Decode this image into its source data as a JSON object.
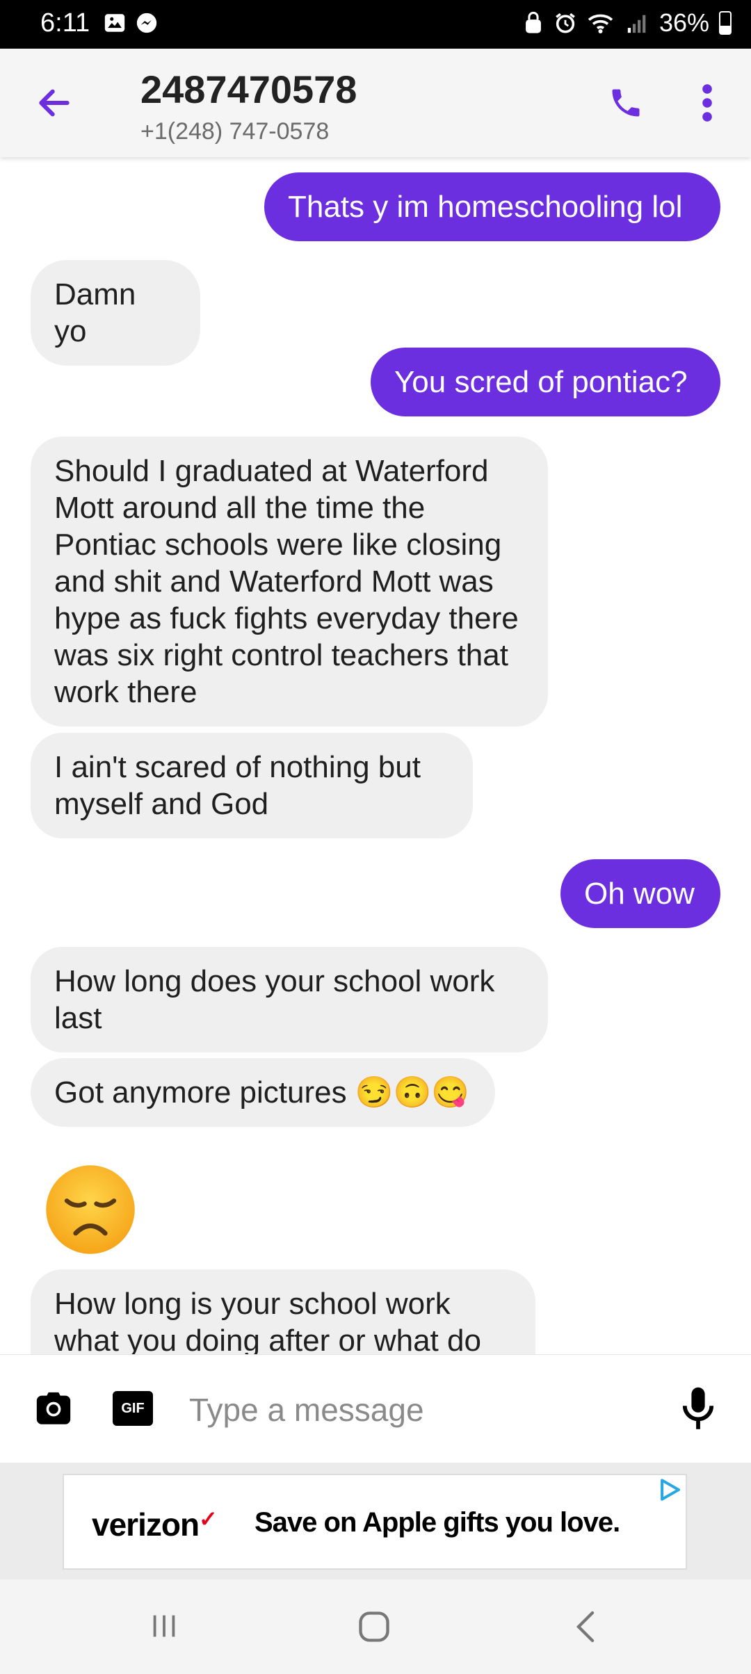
{
  "status_bar": {
    "time": "6:11",
    "battery": "36%",
    "battery_level": 0.36
  },
  "header": {
    "contact_name": "2487470578",
    "contact_number": "+1(248) 747-0578"
  },
  "messages": [
    {
      "direction": "out",
      "text": "Thats y im homeschooling lol"
    },
    {
      "direction": "in",
      "text": "Damn yo"
    },
    {
      "direction": "out",
      "text": "You scred of pontiac?"
    },
    {
      "direction": "in",
      "text": "Should I graduated at Waterford Mott around all the time the Pontiac schools were like closing and shit and Waterford Mott was hype as fuck fights everyday there was six right control teachers that work there"
    },
    {
      "direction": "in",
      "text": "I ain't scared of nothing but myself and God"
    },
    {
      "direction": "out",
      "text": "Oh wow"
    },
    {
      "direction": "in",
      "text": "How long does your school work last"
    },
    {
      "direction": "in",
      "text": "Got anymore pictures 😏🙃😋"
    },
    {
      "direction": "in",
      "emoji": "disappointed-face-emoji"
    },
    {
      "direction": "in",
      "text": "How long is your school work what you doing after or what do"
    }
  ],
  "composer": {
    "placeholder": "Type a message",
    "gif_label": "GIF"
  },
  "ad": {
    "brand": "verizon",
    "text": "Save on Apple gifts you love."
  },
  "colors": {
    "accent": "#6c2fe0",
    "incoming_bubble": "#efefef",
    "outgoing_bubble": "#6c2fe0"
  }
}
